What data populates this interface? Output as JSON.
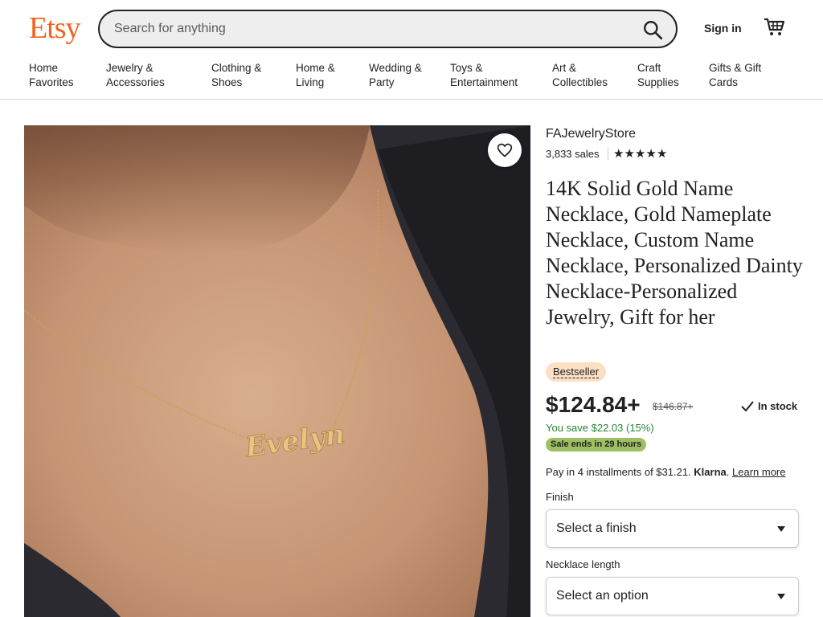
{
  "header": {
    "logo": "Etsy",
    "search_placeholder": "Search for anything",
    "search_icon": "search-icon",
    "signin_label": "Sign in",
    "cart_icon": "cart-icon"
  },
  "nav": {
    "items": [
      {
        "line1": "Home",
        "line2": "Favorites"
      },
      {
        "line1": "Jewelry &",
        "line2": "Accessories"
      },
      {
        "line1": "Clothing &",
        "line2": "Shoes"
      },
      {
        "line1": "Home &",
        "line2": "Living"
      },
      {
        "line1": "Wedding &",
        "line2": "Party"
      },
      {
        "line1": "Toys &",
        "line2": "Entertainment"
      },
      {
        "line1": "Art &",
        "line2": "Collectibles"
      },
      {
        "line1": "Craft",
        "line2": "Supplies"
      },
      {
        "line1": "Gifts & Gift",
        "line2": "Cards"
      }
    ]
  },
  "product": {
    "image_text": "Evelyn",
    "favorite_icon": "heart-icon",
    "shop_name": "FAJewelryStore",
    "sales": "3,833 sales",
    "rating_stars": 5,
    "title": "14K Solid Gold Name Necklace, Gold Nameplate Necklace, Custom Name Necklace, Personalized Dainty Necklace-Personalized Jewelry, Gift for her",
    "badge": "Bestseller",
    "price": "$124.84+",
    "original_price": "$146.87+",
    "stock": "In stock",
    "savings": "You save $22.03 (15%)",
    "sale_ends": "Sale ends in 29 hours",
    "klarna_prefix": "Pay in 4 installments of $31.21.",
    "klarna_brand": "Klarna",
    "klarna_sep": ".",
    "klarna_link": "Learn more"
  },
  "options": {
    "finish_label": "Finish",
    "finish_value": "Select a finish",
    "length_label": "Necklace length",
    "length_value": "Select an option"
  },
  "colors": {
    "brand": "#f1641e",
    "save_green": "#258635",
    "sale_badge": "#9ec063",
    "bestseller_badge": "#fddfc4"
  }
}
